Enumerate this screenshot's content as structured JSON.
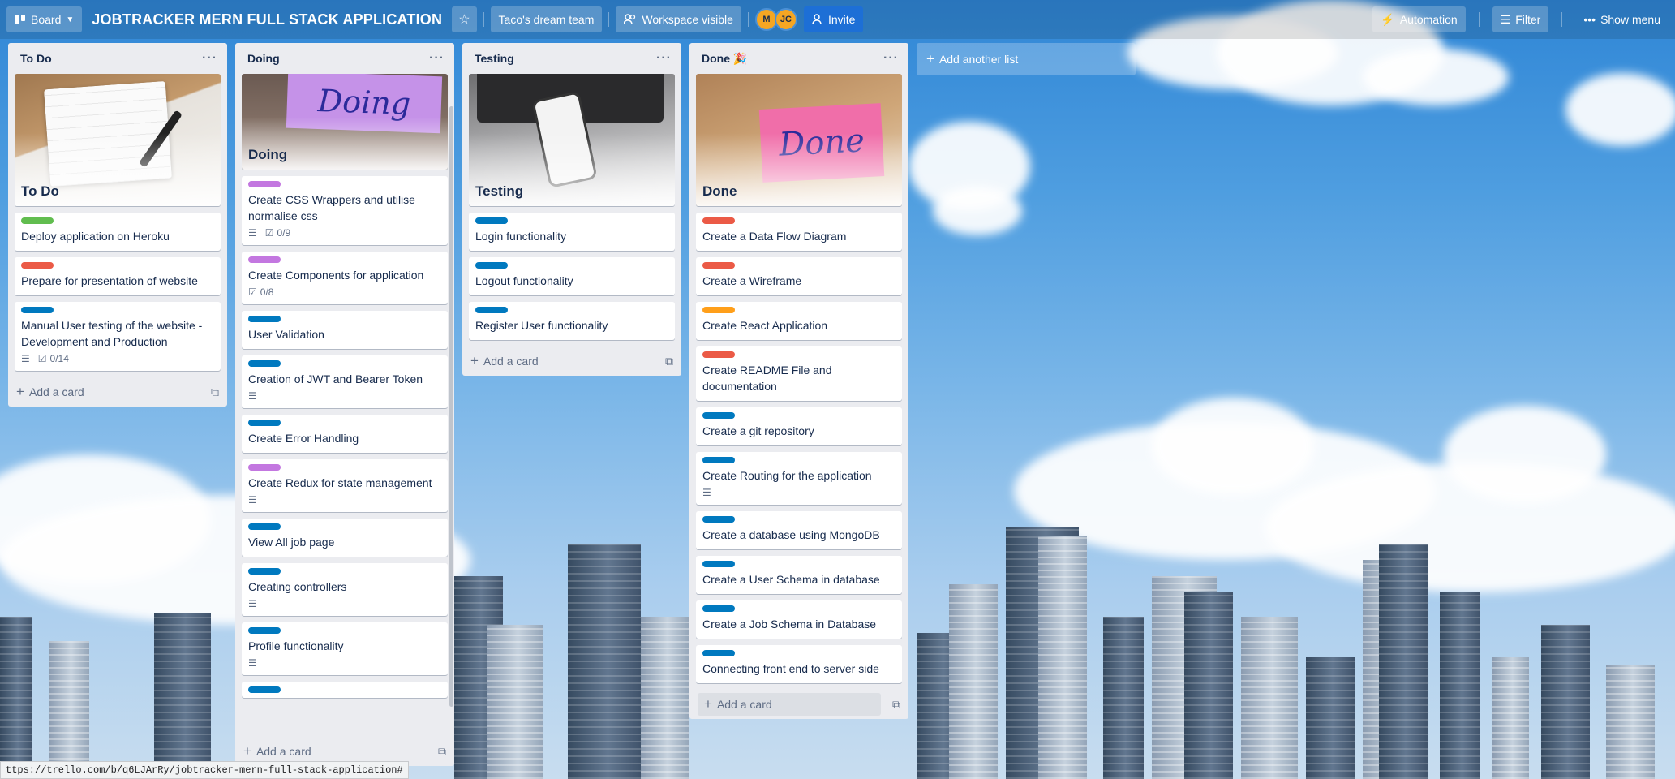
{
  "header": {
    "board_switch": "Board",
    "title": "JOBTRACKER MERN FULL STACK APPLICATION",
    "team": "Taco's dream team",
    "visibility": "Workspace visible",
    "members": [
      "M",
      "JC"
    ],
    "invite": "Invite",
    "automation": "Automation",
    "filter": "Filter",
    "show_menu": "Show menu"
  },
  "lists": [
    {
      "title": "To Do",
      "cover_label": "To Do",
      "cards": [
        {
          "label_color": "#61bd4f",
          "title": "Deploy application on Heroku"
        },
        {
          "label_color": "#eb5a46",
          "title": "Prepare for presentation of website"
        },
        {
          "label_color": "#0079bf",
          "title": "Manual User testing of the website - Development and Production",
          "checklist": "0/14"
        }
      ],
      "add_card": "Add a card"
    },
    {
      "title": "Doing",
      "cover_label": "Doing",
      "cover_text": "Doing",
      "cards": [
        {
          "label_color": "#c377e0",
          "title": "Create CSS Wrappers and utilise normalise css",
          "checklist": "0/9"
        },
        {
          "label_color": "#c377e0",
          "title": "Create Components for application",
          "checklist": "0/8"
        },
        {
          "label_color": "#0079bf",
          "title": "User Validation"
        },
        {
          "label_color": "#0079bf",
          "title": "Creation of JWT and Bearer Token"
        },
        {
          "label_color": "#0079bf",
          "title": "Create Error Handling"
        },
        {
          "label_color": "#c377e0",
          "title": "Create Redux for state management"
        },
        {
          "label_color": "#0079bf",
          "title": "View All job page"
        },
        {
          "label_color": "#0079bf",
          "title": "Creating controllers"
        },
        {
          "label_color": "#0079bf",
          "title": "Profile functionality"
        }
      ],
      "add_card": "Add a card"
    },
    {
      "title": "Testing",
      "cover_label": "Testing",
      "cards": [
        {
          "label_color": "#0079bf",
          "title": "Login functionality"
        },
        {
          "label_color": "#0079bf",
          "title": "Logout functionality"
        },
        {
          "label_color": "#0079bf",
          "title": "Register User functionality"
        }
      ],
      "add_card": "Add a card"
    },
    {
      "title": "Done 🎉",
      "cover_label": "Done",
      "cover_text": "Done",
      "cards": [
        {
          "label_color": "#eb5a46",
          "title": "Create a Data Flow Diagram"
        },
        {
          "label_color": "#eb5a46",
          "title": "Create a Wireframe"
        },
        {
          "label_color": "#ff9f1a",
          "title": "Create React Application"
        },
        {
          "label_color": "#eb5a46",
          "title": "Create README File and documentation"
        },
        {
          "label_color": "#0079bf",
          "title": "Create a git repository"
        },
        {
          "label_color": "#0079bf",
          "title": "Create Routing for the application"
        },
        {
          "label_color": "#0079bf",
          "title": "Create a database using MongoDB"
        },
        {
          "label_color": "#0079bf",
          "title": "Create a User Schema in database"
        },
        {
          "label_color": "#0079bf",
          "title": "Create a Job Schema in Database"
        },
        {
          "label_color": "#0079bf",
          "title": "Connecting front end to server side"
        }
      ],
      "add_card": "Add a card"
    }
  ],
  "add_list": "Add another list",
  "status_url": "ttps://trello.com/b/q6LJArRy/jobtracker-mern-full-stack-application#"
}
